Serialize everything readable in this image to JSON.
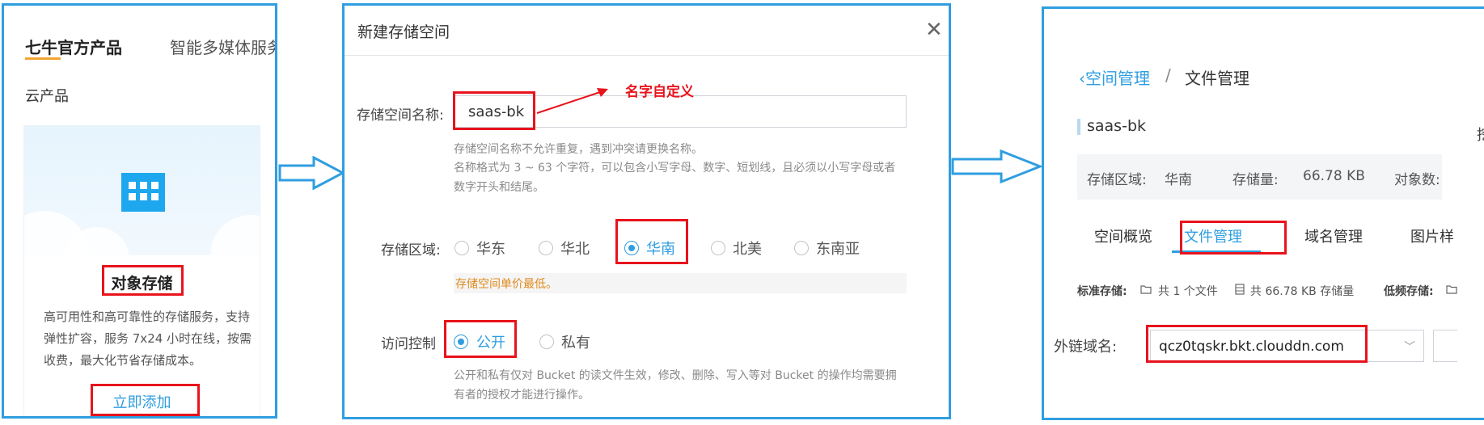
{
  "panel1": {
    "tab_active": "七牛官方产品",
    "tab_inactive": "智能多媒体服务",
    "category": "云产品",
    "card": {
      "title": "对象存储",
      "description": "高可用性和高可靠性的存储服务，支持弹性扩容，服务 7x24 小时在线，按需收费，最大化节省存储成本。",
      "action_label": "立即添加",
      "icon": "building-grid-icon"
    }
  },
  "panel2": {
    "dialog_title": "新建存储空间",
    "close_glyph": "✕",
    "name_label": "存储空间名称:",
    "name_value": "saas-bk",
    "annotation": "名字自定义",
    "name_hint_1": "存储空间名称不允许重复，遇到冲突请更换名称。",
    "name_hint_2": "名称格式为 3 ~ 63 个字符，可以包含小写字母、数字、短划线，且必须以小写字母或者数字开头和结尾。",
    "region_label": "存储区域:",
    "regions": [
      {
        "label": "华东",
        "selected": false
      },
      {
        "label": "华北",
        "selected": false
      },
      {
        "label": "华南",
        "selected": true
      },
      {
        "label": "北美",
        "selected": false
      },
      {
        "label": "东南亚",
        "selected": false
      }
    ],
    "region_note": "存储空间单价最低。",
    "access_label": "访问控制",
    "access_options": [
      {
        "label": "公开",
        "selected": true
      },
      {
        "label": "私有",
        "selected": false
      }
    ],
    "access_hint": "公开和私有仅对 Bucket 的读文件生效，修改、删除、写入等对 Bucket 的操作均需要拥有者的授权才能进行操作。"
  },
  "panel3": {
    "breadcrumb_back": "空间管理",
    "breadcrumb_sep": "/",
    "breadcrumb_current": "文件管理",
    "bucket_name": "saas-bk",
    "info": {
      "region_label": "存储区域:",
      "region_value": "华南",
      "size_label": "存储量:",
      "size_value": "66.78 KB",
      "objects_label": "对象数:"
    },
    "tabs": [
      "空间概览",
      "文件管理",
      "域名管理",
      "图片样"
    ],
    "active_tab": "文件管理",
    "stats": {
      "standard_label": "标准存储:",
      "file_count": "共 1 个文件",
      "total_size": "共 66.78 KB 存储量",
      "low_freq_label": "低频存储:"
    },
    "domain_label": "外链域名:",
    "domain_value": "qcz0tqskr.bkt.clouddn.com",
    "edge_glyph": "挖"
  },
  "colors": {
    "accent": "#2f9ee0",
    "highlight": "#e8131c",
    "tab_underline": "#f3a533",
    "note_text": "#e08a1e"
  }
}
